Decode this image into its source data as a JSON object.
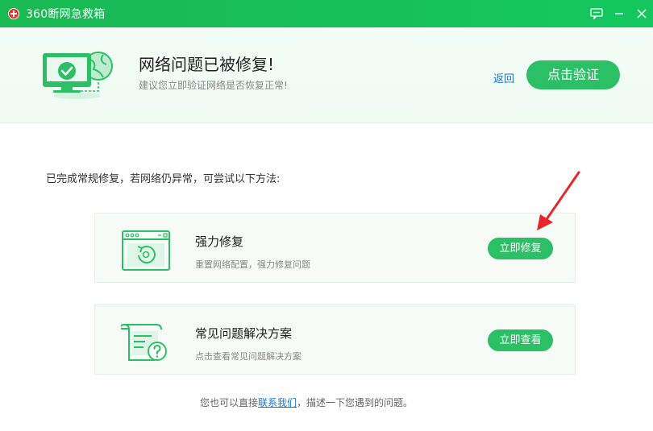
{
  "window": {
    "title": "360断网急救箱"
  },
  "header": {
    "title": "网络问题已被修复!",
    "subtitle": "建议您立即验证网络是否恢复正常!",
    "back_label": "返回",
    "verify_label": "点击验证"
  },
  "hint": "已完成常规修复，若网络仍异常，可尝试以下方法:",
  "cards": [
    {
      "title": "强力修复",
      "desc": "重置网络配置，强力修复问题",
      "button": "立即修复",
      "icon": "browser-repair-icon"
    },
    {
      "title": "常见问题解决方案",
      "desc": "点击查看常见问题解决方案",
      "button": "立即查看",
      "icon": "help-document-icon"
    }
  ],
  "footer": {
    "before": "您也可以直接",
    "link": "联系我们",
    "after": "，描述一下您遇到的问题。"
  },
  "colors": {
    "brand_green": "#2bc065",
    "titlebar_green": "#17c05a",
    "link_blue": "#1a73d9",
    "arrow_red": "#e8262a"
  }
}
